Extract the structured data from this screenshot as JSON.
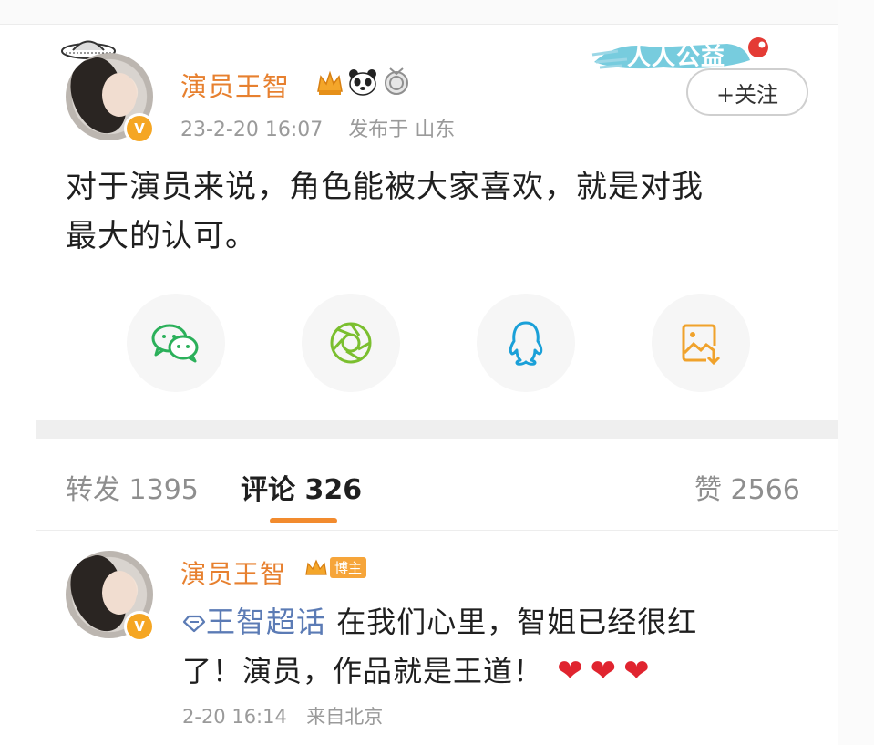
{
  "post": {
    "username": "演员王智",
    "timestamp": "23-2-20 16:07",
    "location": "发布于 山东",
    "text_line1": "对于演员来说，角色能被大家喜欢，就是对我",
    "text_line2": "最大的认可。",
    "follow_label": "+关注",
    "gongyi_label": "人人公益",
    "badges": [
      "crown-icon",
      "panda-icon",
      "medal-icon"
    ]
  },
  "share": {
    "items": [
      {
        "icon": "wechat-icon",
        "color": "#2bb05a"
      },
      {
        "icon": "moments-icon",
        "color": "#7bbf2f"
      },
      {
        "icon": "qq-icon",
        "color": "#1aa0d8"
      },
      {
        "icon": "save-image-icon",
        "color": "#f0a22b"
      }
    ]
  },
  "tabs": {
    "repost_label": "转发",
    "repost_count": "1395",
    "comment_label": "评论",
    "comment_count": "326",
    "like_label": "赞",
    "like_count": "2566"
  },
  "comment": {
    "username": "演员王智",
    "blogger_tag": "博主",
    "topic": "王智超话",
    "text_a": " 在我们心里，智姐已经很红",
    "text_b": "了！演员，作品就是王道！",
    "hearts": "❤❤❤",
    "timestamp": "2-20 16:14",
    "source": "来自北京"
  },
  "colors": {
    "username": "#e7802f",
    "accent_underline": "#f28b2e",
    "topic": "#5b7bb5",
    "heart": "#e0242f"
  }
}
